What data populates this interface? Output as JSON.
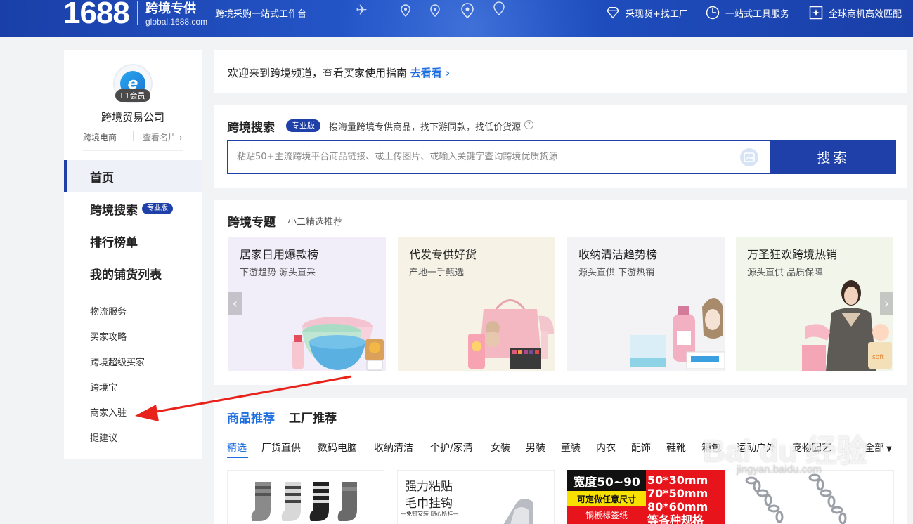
{
  "header": {
    "logo_number": "1688",
    "logo_title": "跨境专供",
    "logo_domain": "global.1688.com",
    "slogan": "跨境采购一站式工作台",
    "links": [
      {
        "label": "采现货+找工厂",
        "icon": "diamond-icon"
      },
      {
        "label": "一站式工具服务",
        "icon": "clock-icon"
      },
      {
        "label": "全球商机高效匹配",
        "icon": "sparkle-icon"
      }
    ]
  },
  "sidebar": {
    "member_badge": "L1会员",
    "company_name": "跨境贸易公司",
    "company_type": "跨境电商",
    "view_card": "查看名片",
    "nav": [
      {
        "label": "首页"
      },
      {
        "label": "跨境搜索",
        "tag": "专业版"
      },
      {
        "label": "排行榜单"
      },
      {
        "label": "我的铺货列表"
      }
    ],
    "sub_items": [
      "物流服务",
      "买家攻略",
      "跨境超级买家",
      "跨境宝",
      "商家入驻",
      "提建议"
    ]
  },
  "welcome": {
    "text": "欢迎来到跨境频道，查看买家使用指南",
    "link": "去看看"
  },
  "search": {
    "title": "跨境搜索",
    "tag": "专业版",
    "description": "搜海量跨境专供商品，找下游同款，找低价货源",
    "placeholder": "粘贴50+主流跨境平台商品链接、或上传图片、或输入关键字查询跨境优质货源",
    "button": "搜索"
  },
  "topics": {
    "title": "跨境专题",
    "subtitle": "小二精选推荐",
    "cards": [
      {
        "title": "居家日用爆款榜",
        "subtitle": "下游趋势 源头直采"
      },
      {
        "title": "代发专供好货",
        "subtitle": "产地一手甄选"
      },
      {
        "title": "收纳清洁趋势榜",
        "subtitle": "源头直供 下游热销"
      },
      {
        "title": "万圣狂欢跨境热销",
        "subtitle": "源头直供 品质保障"
      }
    ]
  },
  "recommend": {
    "tab_products": "商品推荐",
    "tab_factory": "工厂推荐",
    "categories": [
      "精选",
      "厂货直供",
      "数码电脑",
      "收纳清洁",
      "个护/家清",
      "女装",
      "男装",
      "童装",
      "内衣",
      "配饰",
      "鞋靴",
      "箱包",
      "运动户外",
      "宠物园艺"
    ],
    "all_label": "全部",
    "product_texts": {
      "hook_title_1": "强力粘贴",
      "hook_title_2": "毛巾挂钩",
      "hook_sub": "—免钉安装 随心所挂—",
      "sign_width": "宽度50~90",
      "sign_custom": "可定做任意尺寸",
      "sign_material": "铜板标签纸",
      "size_1": "50*30mm",
      "size_2": "70*50mm",
      "size_3": "80*60mm",
      "size_more": "等各种规格"
    }
  },
  "watermark": {
    "brand": "Bai du 经验",
    "domain": "jingyan.baidu.com"
  },
  "colors": {
    "brand_blue": "#1e40a8",
    "link_blue": "#1f6fe0",
    "header_blue": "#2456c9"
  }
}
